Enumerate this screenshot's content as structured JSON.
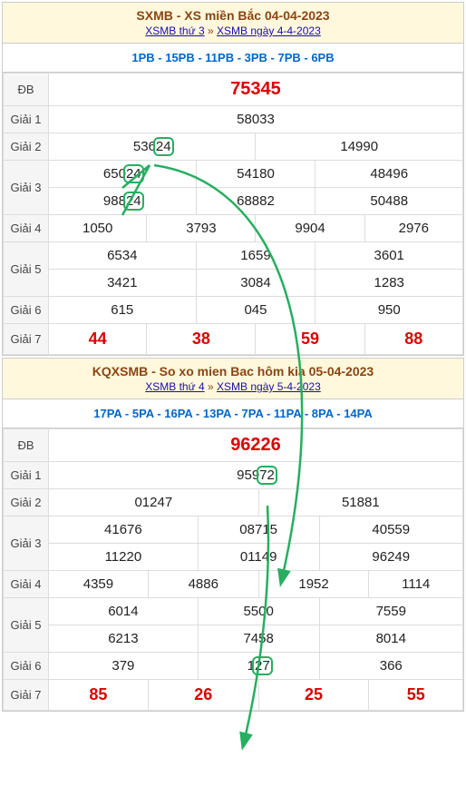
{
  "t1": {
    "title": "SXMB - XS miền Bắc 04-04-2023",
    "link1": "XSMB thứ 3",
    "link2": "XSMB ngày 4-4-2023",
    "codes": "1PB - 15PB - 11PB - 3PB - 7PB - 6PB",
    "db": "75345",
    "g1": "58033",
    "g2": [
      "53624",
      "14990"
    ],
    "g3": [
      "65024",
      "54180",
      "48496",
      "98824",
      "68882",
      "50488"
    ],
    "g4": [
      "1050",
      "3793",
      "9904",
      "2976"
    ],
    "g5": [
      "6534",
      "1659",
      "3601",
      "3421",
      "3084",
      "1283"
    ],
    "g6": [
      "615",
      "045",
      "950"
    ],
    "g7": [
      "44",
      "38",
      "59",
      "88"
    ]
  },
  "t2": {
    "title": "KQXSMB - So xo mien Bac hôm kia 05-04-2023",
    "link1": "XSMB thứ 4",
    "link2": "XSMB ngày 5-4-2023",
    "codes": "17PA - 5PA - 16PA - 13PA - 7PA - 11PA - 8PA - 14PA",
    "db": "96226",
    "g1": "95972",
    "g2": [
      "01247",
      "51881"
    ],
    "g3": [
      "41676",
      "08715",
      "40559",
      "11220",
      "01149",
      "96249"
    ],
    "g4": [
      "4359",
      "4886",
      "1952",
      "1114"
    ],
    "g5": [
      "6014",
      "5500",
      "7559",
      "6213",
      "7458",
      "8014"
    ],
    "g6": [
      "379",
      "127",
      "366"
    ],
    "g7": [
      "85",
      "26",
      "25",
      "55"
    ]
  },
  "lbl": {
    "db": "ĐB",
    "g1": "Giải 1",
    "g2": "Giải 2",
    "g3": "Giải 3",
    "g4": "Giải 4",
    "g5": "Giải 5",
    "g6": "Giải 6",
    "g7": "Giải 7"
  },
  "sep": "»"
}
